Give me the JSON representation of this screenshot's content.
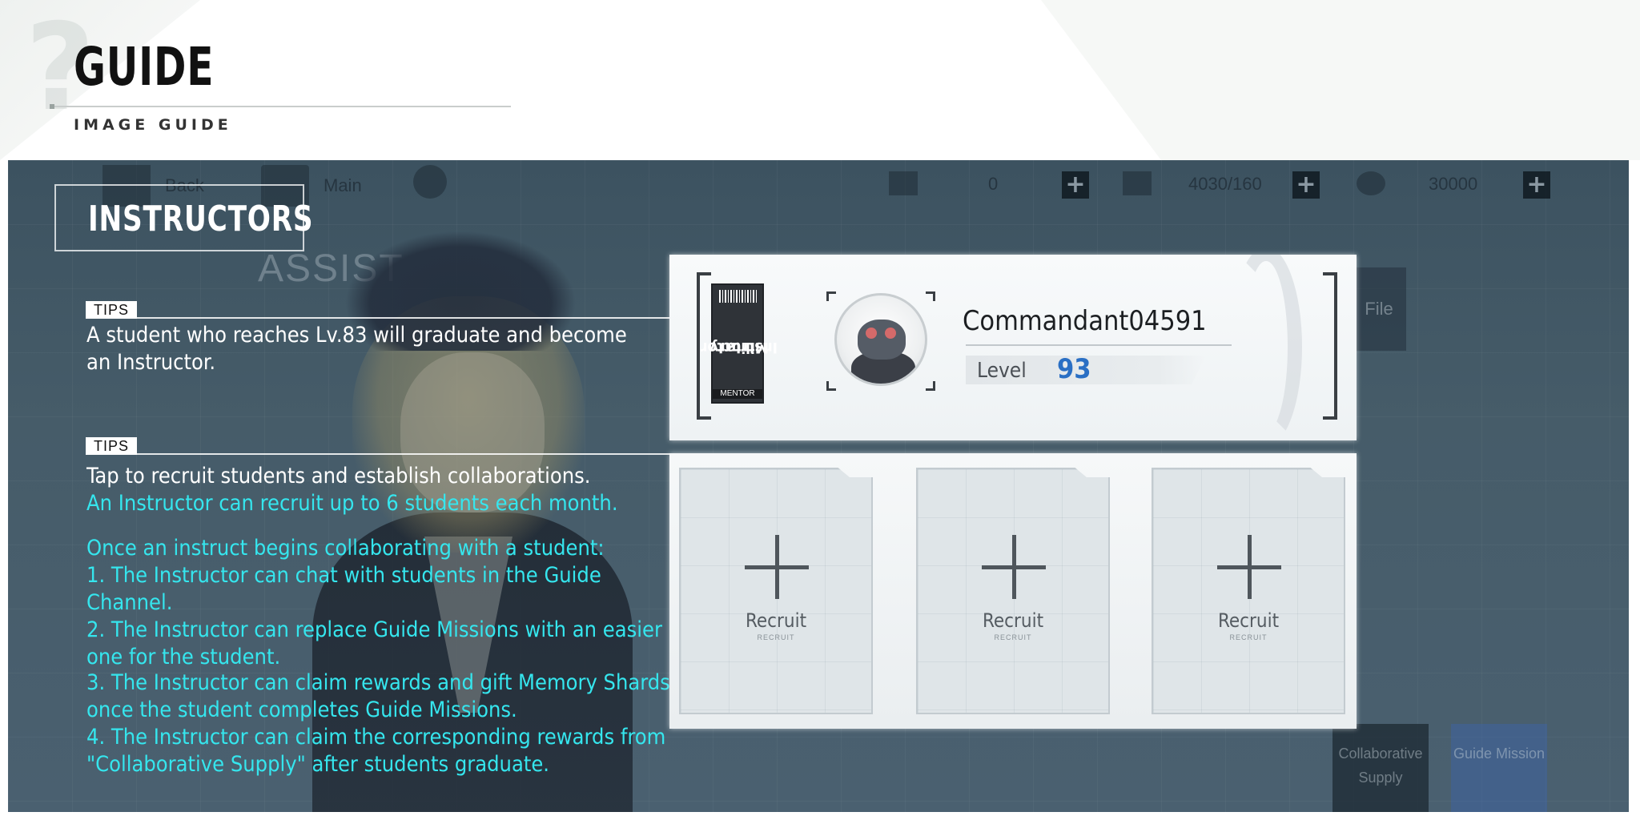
{
  "header": {
    "title": "GUIDE",
    "subtitle": "IMAGE GUIDE"
  },
  "background_ui": {
    "back_label": "Back",
    "main_label": "Main",
    "currency_1": "0",
    "currency_2": "4030/160",
    "currency_3": "30000",
    "assist_text": "ASSIST",
    "file_label": "File",
    "collab_supply_label": "Collaborative Supply",
    "guide_mission_label": "Guide Mission"
  },
  "panel": {
    "section_title": "INSTRUCTORS",
    "tips": [
      {
        "badge": "TIPS",
        "lines_white": [
          "A student who reaches Lv.83 will graduate and become",
          "an Instructor."
        ]
      },
      {
        "badge": "TIPS",
        "line_white": "Tap to recruit students and establish collaborations.",
        "line_cyan": "An Instructor can recruit up to 6 students each month.",
        "list_lines": [
          "Once an instruct begins collaborating with a student:",
          "1. The Instructor can chat with students in the Guide",
          "Channel.",
          "2. The Instructor can replace Guide Missions with an easier",
          "one for the student.",
          "3. The Instructor can claim rewards and gift Memory Shards",
          "once the student completes Guide Missions.",
          "4. The Instructor can claim the corresponding rewards from",
          "\"Collaborative Supply\" after students graduate."
        ]
      }
    ]
  },
  "profile": {
    "role_line1": "Military",
    "role_line2": "Instructor",
    "role_tag": "MENTOR",
    "username": "Commandant04591",
    "level_label": "Level",
    "level_value": "93"
  },
  "recruit_slots": [
    {
      "label": "Recruit",
      "sub": "RECRUIT"
    },
    {
      "label": "Recruit",
      "sub": "RECRUIT"
    },
    {
      "label": "Recruit",
      "sub": "RECRUIT"
    }
  ],
  "icons": [
    "help-icon",
    "back-icon",
    "home-icon",
    "alert-icon",
    "plus-icon",
    "avatar-icon"
  ]
}
